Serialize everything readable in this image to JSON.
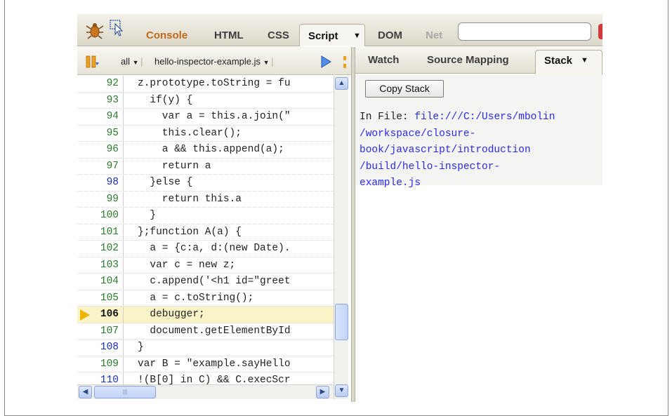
{
  "toolbar": {
    "tabs": [
      "Console",
      "HTML",
      "CSS",
      "Script",
      "DOM",
      "Net"
    ],
    "active_tab": "Script",
    "search_value": ""
  },
  "script_panel": {
    "filter": "all",
    "file": "hello-inspector-example.js"
  },
  "code": {
    "lines": [
      {
        "num": "92",
        "text": "z.prototype.toString = fu",
        "num_color": "green"
      },
      {
        "num": "93",
        "text": "  if(y) {",
        "num_color": "green"
      },
      {
        "num": "94",
        "text": "    var a = this.a.join(\"",
        "num_color": "green"
      },
      {
        "num": "95",
        "text": "    this.clear();",
        "num_color": "green"
      },
      {
        "num": "96",
        "text": "    a && this.append(a);",
        "num_color": "green"
      },
      {
        "num": "97",
        "text": "    return a",
        "num_color": "green"
      },
      {
        "num": "98",
        "text": "  }else {",
        "num_color": "blue"
      },
      {
        "num": "99",
        "text": "    return this.a",
        "num_color": "green"
      },
      {
        "num": "100",
        "text": "  }",
        "num_color": "green"
      },
      {
        "num": "101",
        "text": "};function A(a) {",
        "num_color": "green"
      },
      {
        "num": "102",
        "text": "  a = {c:a, d:(new Date).",
        "num_color": "green"
      },
      {
        "num": "103",
        "text": "  var c = new z;",
        "num_color": "green"
      },
      {
        "num": "104",
        "text": "  c.append('<h1 id=\"greet",
        "num_color": "green"
      },
      {
        "num": "105",
        "text": "  a = c.toString();",
        "num_color": "green"
      },
      {
        "num": "106",
        "text": "  debugger;",
        "num_color": "current"
      },
      {
        "num": "107",
        "text": "  document.getElementById",
        "num_color": "green"
      },
      {
        "num": "108",
        "text": "}",
        "num_color": "blue"
      },
      {
        "num": "109",
        "text": "var B = \"example.sayHello",
        "num_color": "green"
      },
      {
        "num": "110",
        "text": "!(B[0] in C) && C.execScr",
        "num_color": "blue"
      }
    ],
    "current_line": "106"
  },
  "side_panel": {
    "tabs": [
      "Watch",
      "Source Mapping",
      "Stack"
    ],
    "active_tab": "Stack",
    "copy_button": "Copy Stack",
    "in_file_label": "In File:",
    "file_path_lines": [
      "file:///C:/Users/mbolin",
      "/workspace/closure-",
      "book/javascript/introduction",
      "/build/hello-inspector-",
      "example.js"
    ]
  },
  "colors": {
    "line_num_green": "#2c7c2c",
    "line_num_blue": "#1a2fc8",
    "current_line_bg": "#f9f3c7",
    "link_blue": "#2a2aee",
    "console_tab": "#bf6a1a"
  }
}
